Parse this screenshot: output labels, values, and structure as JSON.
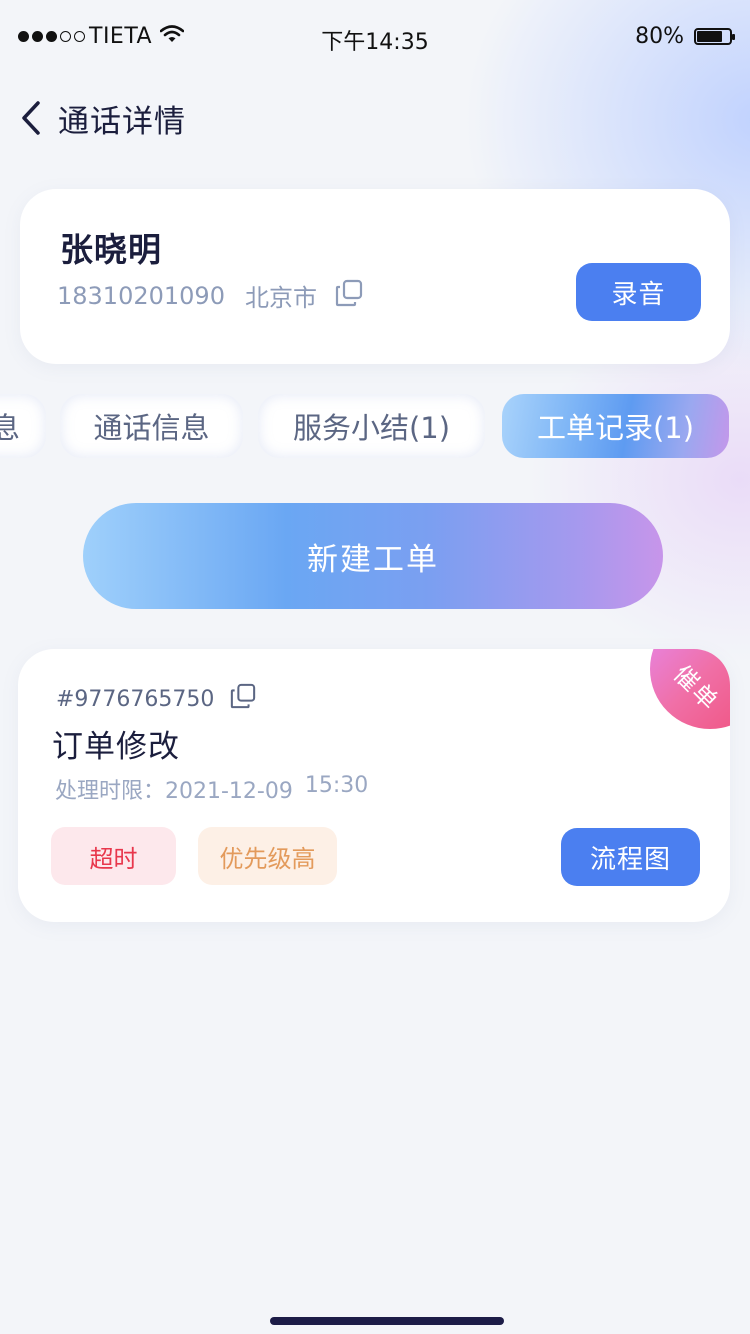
{
  "status_bar": {
    "carrier": "TIETA",
    "time": "下午14:35",
    "battery": "80%",
    "battery_level": 0.8,
    "signal_dots_filled": 3,
    "signal_dots_total": 5
  },
  "header": {
    "title": "通话详情",
    "back_icon": "chevron-left-icon"
  },
  "contact": {
    "name": "张晓明",
    "phone": "18310201090",
    "city": "北京市",
    "record_label": "录音"
  },
  "tabs": [
    {
      "label": "息",
      "active": false
    },
    {
      "label": "通话信息",
      "active": false
    },
    {
      "label": "服务小结(1)",
      "active": false
    },
    {
      "label": "工单记录(1)",
      "active": true
    }
  ],
  "new_order_label": "新建工单",
  "order": {
    "number": "#9776765750",
    "title": "订单修改",
    "deadline_label": "处理时限：2021-12-09",
    "deadline_time": "15:30",
    "urge_badge": "催单",
    "tags": {
      "timeout": "超时",
      "priority": "优先级高"
    },
    "flow_label": "流程图"
  },
  "colors": {
    "primary_button": "#4b7ff0",
    "timeout_text": "#e8374c",
    "priority_text": "#e39a5b",
    "urge_badge": "#f06fa6"
  }
}
